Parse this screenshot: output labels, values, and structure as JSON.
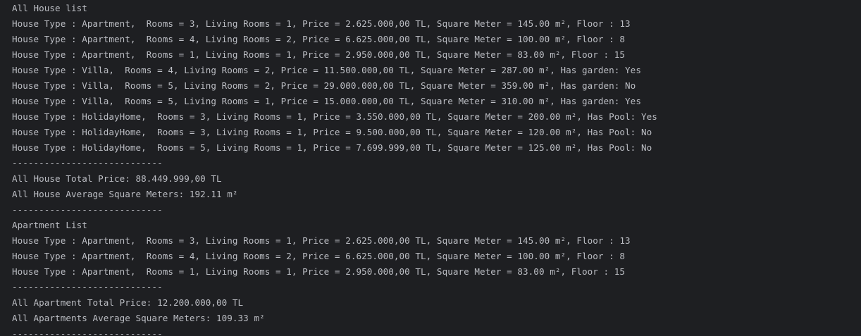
{
  "console": {
    "lines": [
      "All House list",
      "House Type : Apartment,  Rooms = 3, Living Rooms = 1, Price = 2.625.000,00 TL, Square Meter = 145.00 m², Floor : 13",
      "House Type : Apartment,  Rooms = 4, Living Rooms = 2, Price = 6.625.000,00 TL, Square Meter = 100.00 m², Floor : 8",
      "House Type : Apartment,  Rooms = 1, Living Rooms = 1, Price = 2.950.000,00 TL, Square Meter = 83.00 m², Floor : 15",
      "House Type : Villa,  Rooms = 4, Living Rooms = 2, Price = 11.500.000,00 TL, Square Meter = 287.00 m², Has garden: Yes",
      "House Type : Villa,  Rooms = 5, Living Rooms = 2, Price = 29.000.000,00 TL, Square Meter = 359.00 m², Has garden: No",
      "House Type : Villa,  Rooms = 5, Living Rooms = 1, Price = 15.000.000,00 TL, Square Meter = 310.00 m², Has garden: Yes",
      "House Type : HolidayHome,  Rooms = 3, Living Rooms = 1, Price = 3.550.000,00 TL, Square Meter = 200.00 m², Has Pool: Yes",
      "House Type : HolidayHome,  Rooms = 3, Living Rooms = 1, Price = 9.500.000,00 TL, Square Meter = 120.00 m², Has Pool: No",
      "House Type : HolidayHome,  Rooms = 5, Living Rooms = 1, Price = 7.699.999,00 TL, Square Meter = 125.00 m², Has Pool: No",
      "----------------------------",
      "All House Total Price: 88.449.999,00 TL",
      "All House Average Square Meters: 192.11 m²",
      "----------------------------",
      "Apartment List",
      "House Type : Apartment,  Rooms = 3, Living Rooms = 1, Price = 2.625.000,00 TL, Square Meter = 145.00 m², Floor : 13",
      "House Type : Apartment,  Rooms = 4, Living Rooms = 2, Price = 6.625.000,00 TL, Square Meter = 100.00 m², Floor : 8",
      "House Type : Apartment,  Rooms = 1, Living Rooms = 1, Price = 2.950.000,00 TL, Square Meter = 83.00 m², Floor : 15",
      "----------------------------",
      "All Apartment Total Price: 12.200.000,00 TL",
      "All Apartments Average Square Meters: 109.33 m²",
      "----------------------------"
    ]
  },
  "colors": {
    "background": "#1e1f22",
    "text": "#bcbec4"
  }
}
